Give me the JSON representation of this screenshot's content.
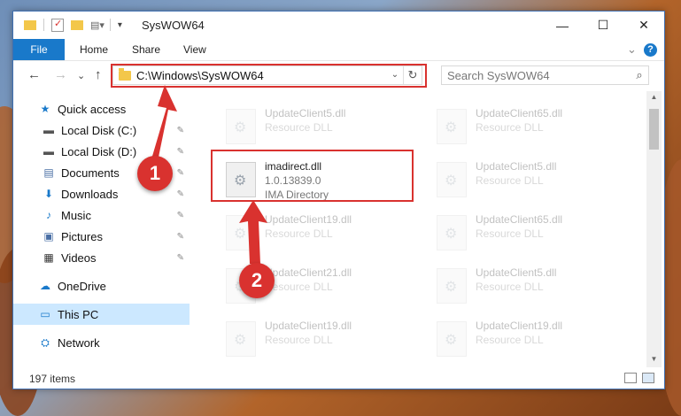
{
  "window": {
    "title": "SysWOW64",
    "minimize_glyph": "—",
    "maximize_glyph": "☐",
    "close_glyph": "✕"
  },
  "ribbon": {
    "file_label": "File",
    "tabs": [
      "Home",
      "Share",
      "View"
    ],
    "expand_glyph": "⌄",
    "help_glyph": "?"
  },
  "nav": {
    "back_glyph": "←",
    "forward_glyph": "→",
    "recent_glyph": "⌄",
    "up_glyph": "↑",
    "address_path": "C:\\Windows\\SysWOW64",
    "address_dropdown_glyph": "⌄",
    "refresh_glyph": "↻",
    "search_placeholder": "Search SysWOW64",
    "search_glyph": "⌕"
  },
  "sidebar": {
    "items": [
      {
        "label": "Quick access",
        "icon": "star-icon",
        "glyph": "★",
        "color": "#1979ca",
        "pinned": false,
        "indent": 0
      },
      {
        "label": "Local Disk (C:)",
        "icon": "drive-icon",
        "glyph": "▬",
        "color": "#555555",
        "pinned": true,
        "indent": 1
      },
      {
        "label": "Local Disk (D:)",
        "icon": "drive-icon",
        "glyph": "▬",
        "color": "#555555",
        "pinned": true,
        "indent": 1
      },
      {
        "label": "Documents",
        "icon": "document-icon",
        "glyph": "▤",
        "color": "#4a6fa5",
        "pinned": true,
        "indent": 1
      },
      {
        "label": "Downloads",
        "icon": "download-arrow-icon",
        "glyph": "⬇",
        "color": "#1979ca",
        "pinned": true,
        "indent": 1
      },
      {
        "label": "Music",
        "icon": "music-note-icon",
        "glyph": "♪",
        "color": "#1979ca",
        "pinned": true,
        "indent": 1
      },
      {
        "label": "Pictures",
        "icon": "pictures-icon",
        "glyph": "▣",
        "color": "#4a6fa5",
        "pinned": true,
        "indent": 1
      },
      {
        "label": "Videos",
        "icon": "film-icon",
        "glyph": "▦",
        "color": "#333333",
        "pinned": true,
        "indent": 1
      },
      {
        "label": "OneDrive",
        "icon": "cloud-icon",
        "glyph": "☁",
        "color": "#1979ca",
        "pinned": false,
        "indent": 0
      },
      {
        "label": "This PC",
        "icon": "computer-icon",
        "glyph": "▭",
        "color": "#1979ca",
        "pinned": false,
        "indent": 0,
        "selected": true
      },
      {
        "label": "Network",
        "icon": "network-icon",
        "glyph": "⛭",
        "color": "#1979ca",
        "pinned": false,
        "indent": 0
      }
    ],
    "pin_glyph": "📌"
  },
  "files": {
    "left_column": [
      {
        "name": "UpdateClient5.dll",
        "type": "Resource DLL",
        "faded": true
      },
      {
        "name": "imadirect.dll",
        "version": "1.0.13839.0",
        "type": "IMA Directory",
        "faded": false,
        "highlighted": true
      },
      {
        "name": "UpdateClient19.dll",
        "type": "Resource DLL",
        "faded": true
      },
      {
        "name": "UpdateClient21.dll",
        "type": "Resource DLL",
        "faded": true
      },
      {
        "name": "UpdateClient19.dll",
        "type": "Resource DLL",
        "faded": true
      }
    ],
    "right_column": [
      {
        "name": "UpdateClient65.dll",
        "type": "Resource DLL",
        "faded": true
      },
      {
        "name": "UpdateClient5.dll",
        "type": "Resource DLL",
        "faded": true
      },
      {
        "name": "UpdateClient65.dll",
        "type": "Resource DLL",
        "faded": true
      },
      {
        "name": "UpdateClient5.dll",
        "type": "Resource DLL",
        "faded": true
      },
      {
        "name": "UpdateClient19.dll",
        "type": "Resource DLL",
        "faded": true
      }
    ]
  },
  "status": {
    "item_count": "197 items"
  },
  "annotations": {
    "marker_1": "1",
    "marker_2": "2",
    "color": "#d9322f"
  }
}
